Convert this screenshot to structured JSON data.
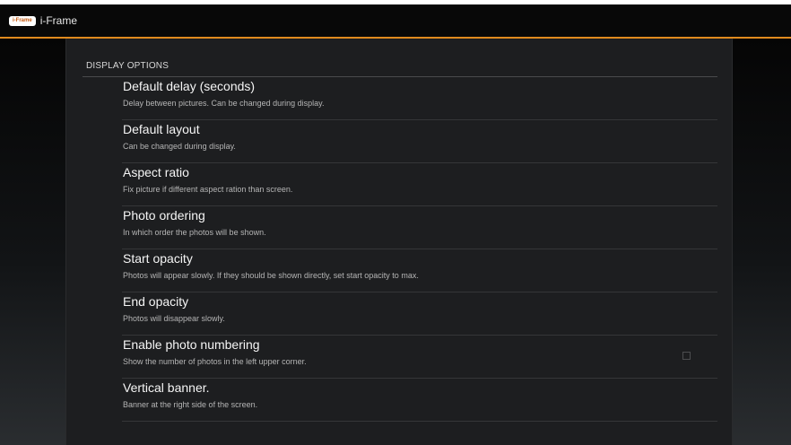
{
  "app": {
    "logo_text": "i-Frame",
    "title": "i-Frame"
  },
  "section": {
    "header": "DISPLAY OPTIONS"
  },
  "preferences": [
    {
      "title": "Default delay (seconds)",
      "summary": "Delay between pictures. Can be changed during display."
    },
    {
      "title": "Default layout",
      "summary": "Can be changed during display."
    },
    {
      "title": "Aspect ratio",
      "summary": "Fix picture if different aspect ration than screen."
    },
    {
      "title": "Photo ordering",
      "summary": "In which order the photos will be shown."
    },
    {
      "title": "Start opacity",
      "summary": "Photos will appear slowly. If they should be shown directly, set start opacity to max."
    },
    {
      "title": "End opacity",
      "summary": "Photos will disappear slowly."
    },
    {
      "title": "Enable photo numbering",
      "summary": "Show the number of photos in the left upper corner.",
      "checkbox": {
        "checked": false
      }
    },
    {
      "title": "Vertical banner.",
      "summary": "Banner at the right side of the screen."
    }
  ],
  "colors": {
    "accent": "#e08a1e",
    "panel_background": "#1d1e20",
    "actionbar_background": "#080808"
  }
}
